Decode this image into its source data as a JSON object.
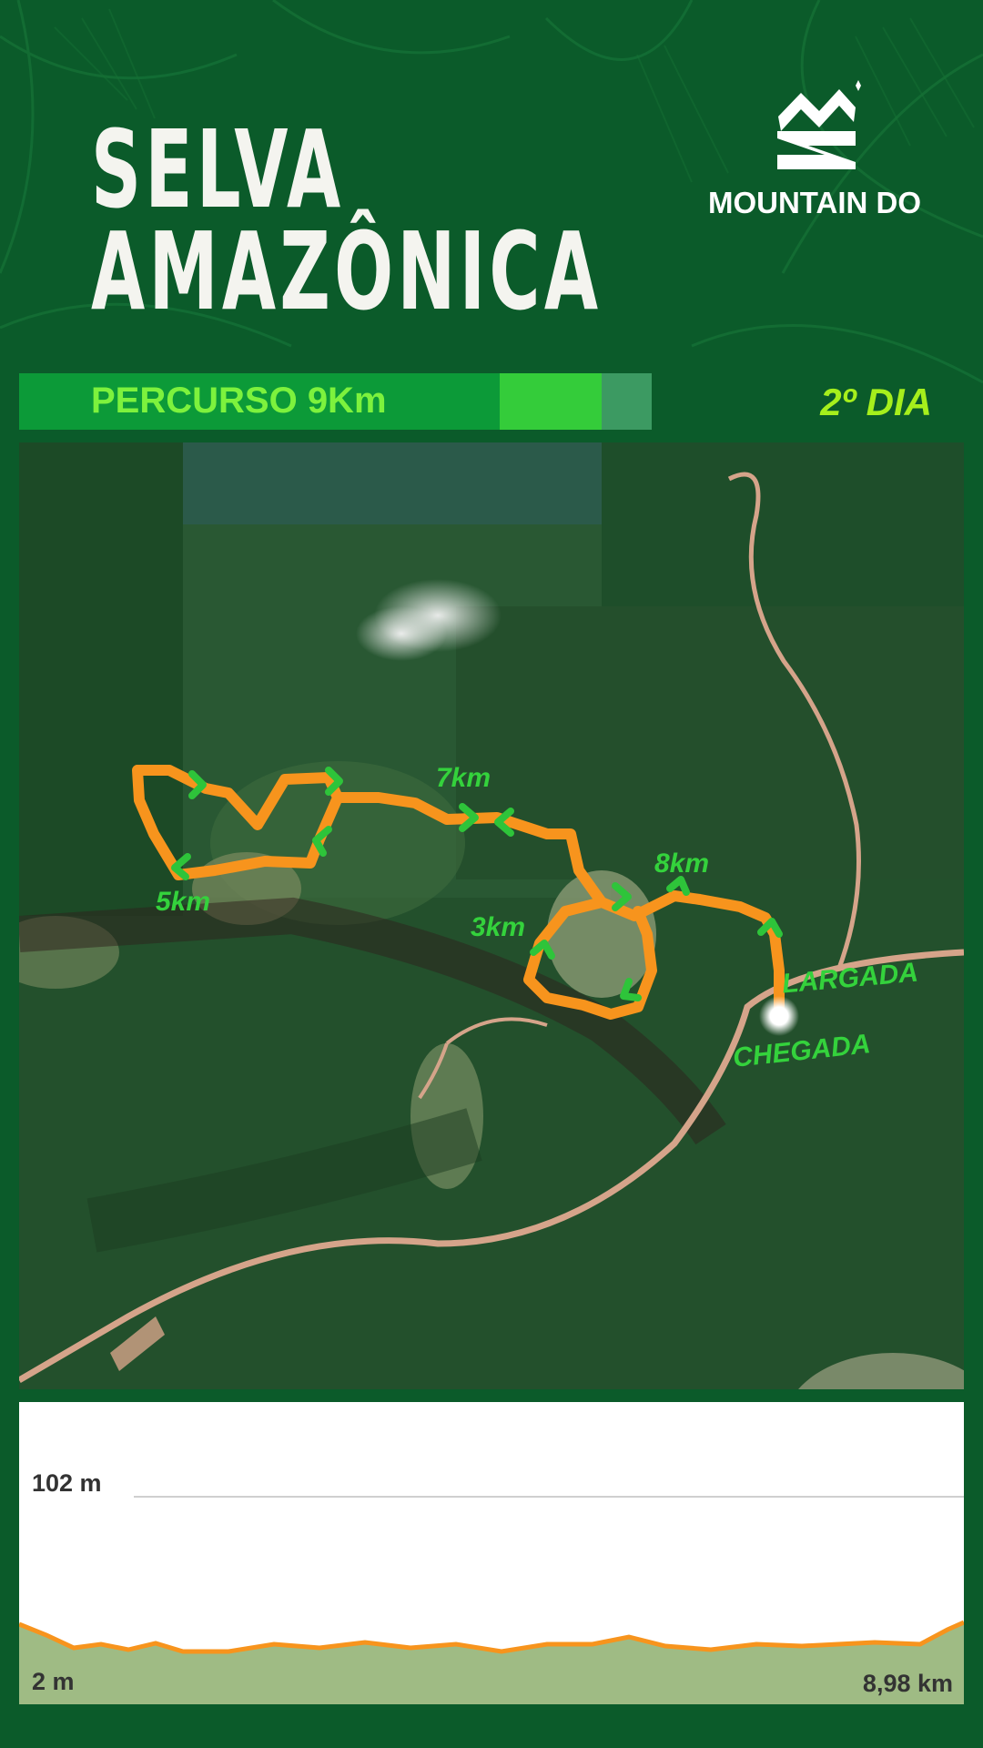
{
  "header": {
    "title_line1": "SELVA",
    "title_line2": "AMAZÔNICA",
    "brand": "MOUNTAIN DO"
  },
  "route": {
    "label": "PERCURSO 9Km",
    "day": "2º DIA"
  },
  "map": {
    "km_markers": [
      "7km",
      "5km",
      "3km",
      "8km"
    ],
    "start_label": "LARGADA",
    "finish_label": "CHEGADA",
    "route_color": "#f7941d",
    "arrow_color": "#2ec43a"
  },
  "elevation": {
    "max_label": "102 m",
    "min_label": "2 m",
    "distance_label": "8,98 km"
  }
}
